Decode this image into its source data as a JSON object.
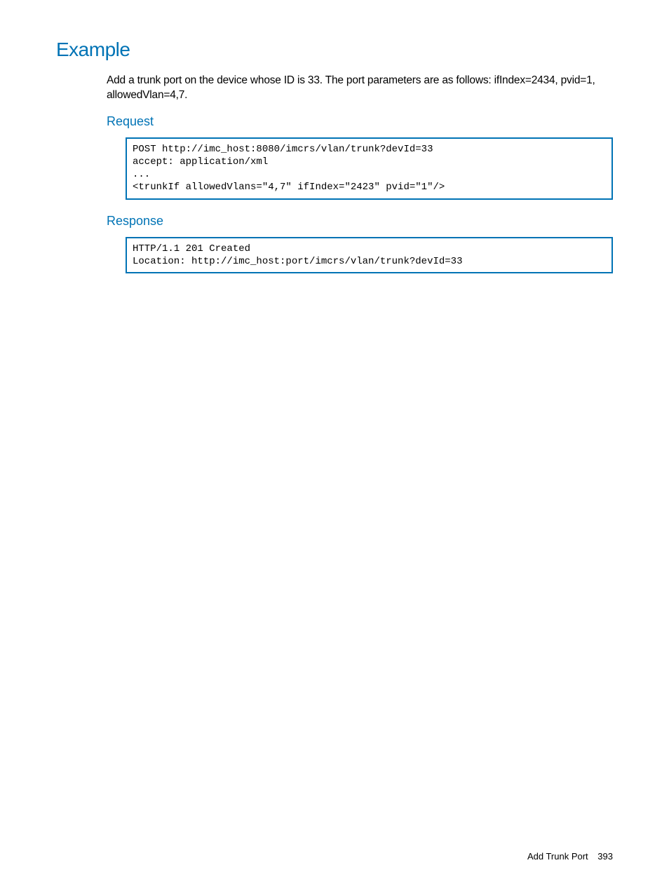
{
  "section": {
    "heading": "Example",
    "description": "Add a trunk port on the device whose ID is 33. The port parameters are as follows: ifIndex=2434, pvid=1, allowedVlan=4,7.",
    "request": {
      "heading": "Request",
      "code": "POST http://imc_host:8080/imcrs/vlan/trunk?devId=33\naccept: application/xml\n...\n<trunkIf allowedVlans=\"4,7\" ifIndex=\"2423\" pvid=\"1\"/>"
    },
    "response": {
      "heading": "Response",
      "code": "HTTP/1.1 201 Created\nLocation: http://imc_host:port/imcrs/vlan/trunk?devId=33"
    }
  },
  "footer": {
    "title": "Add Trunk Port",
    "page": "393"
  }
}
